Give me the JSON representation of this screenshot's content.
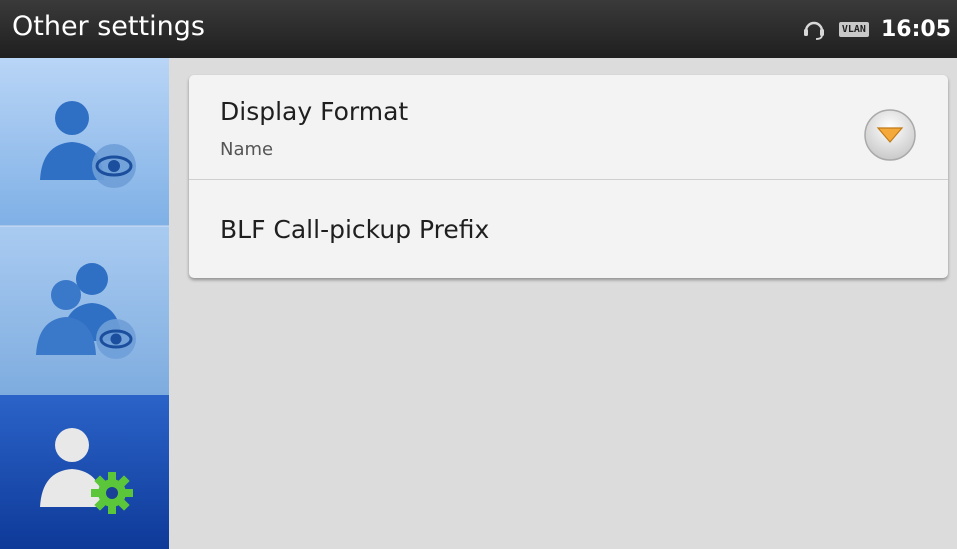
{
  "topbar": {
    "title": "Other settings",
    "vlan_label": "VLAN",
    "time": "16:05"
  },
  "sidebar": {
    "items": [
      {
        "icon": "contact-view-icon",
        "selected": false
      },
      {
        "icon": "group-view-icon",
        "selected": false
      },
      {
        "icon": "contact-settings-icon",
        "selected": true
      }
    ]
  },
  "settings": {
    "display_format": {
      "title": "Display Format",
      "value": "Name"
    },
    "blf_prefix": {
      "title": "BLF Call-pickup Prefix"
    }
  },
  "colors": {
    "accent": "#1d4fb3",
    "dropdown": "#f4a93a"
  }
}
